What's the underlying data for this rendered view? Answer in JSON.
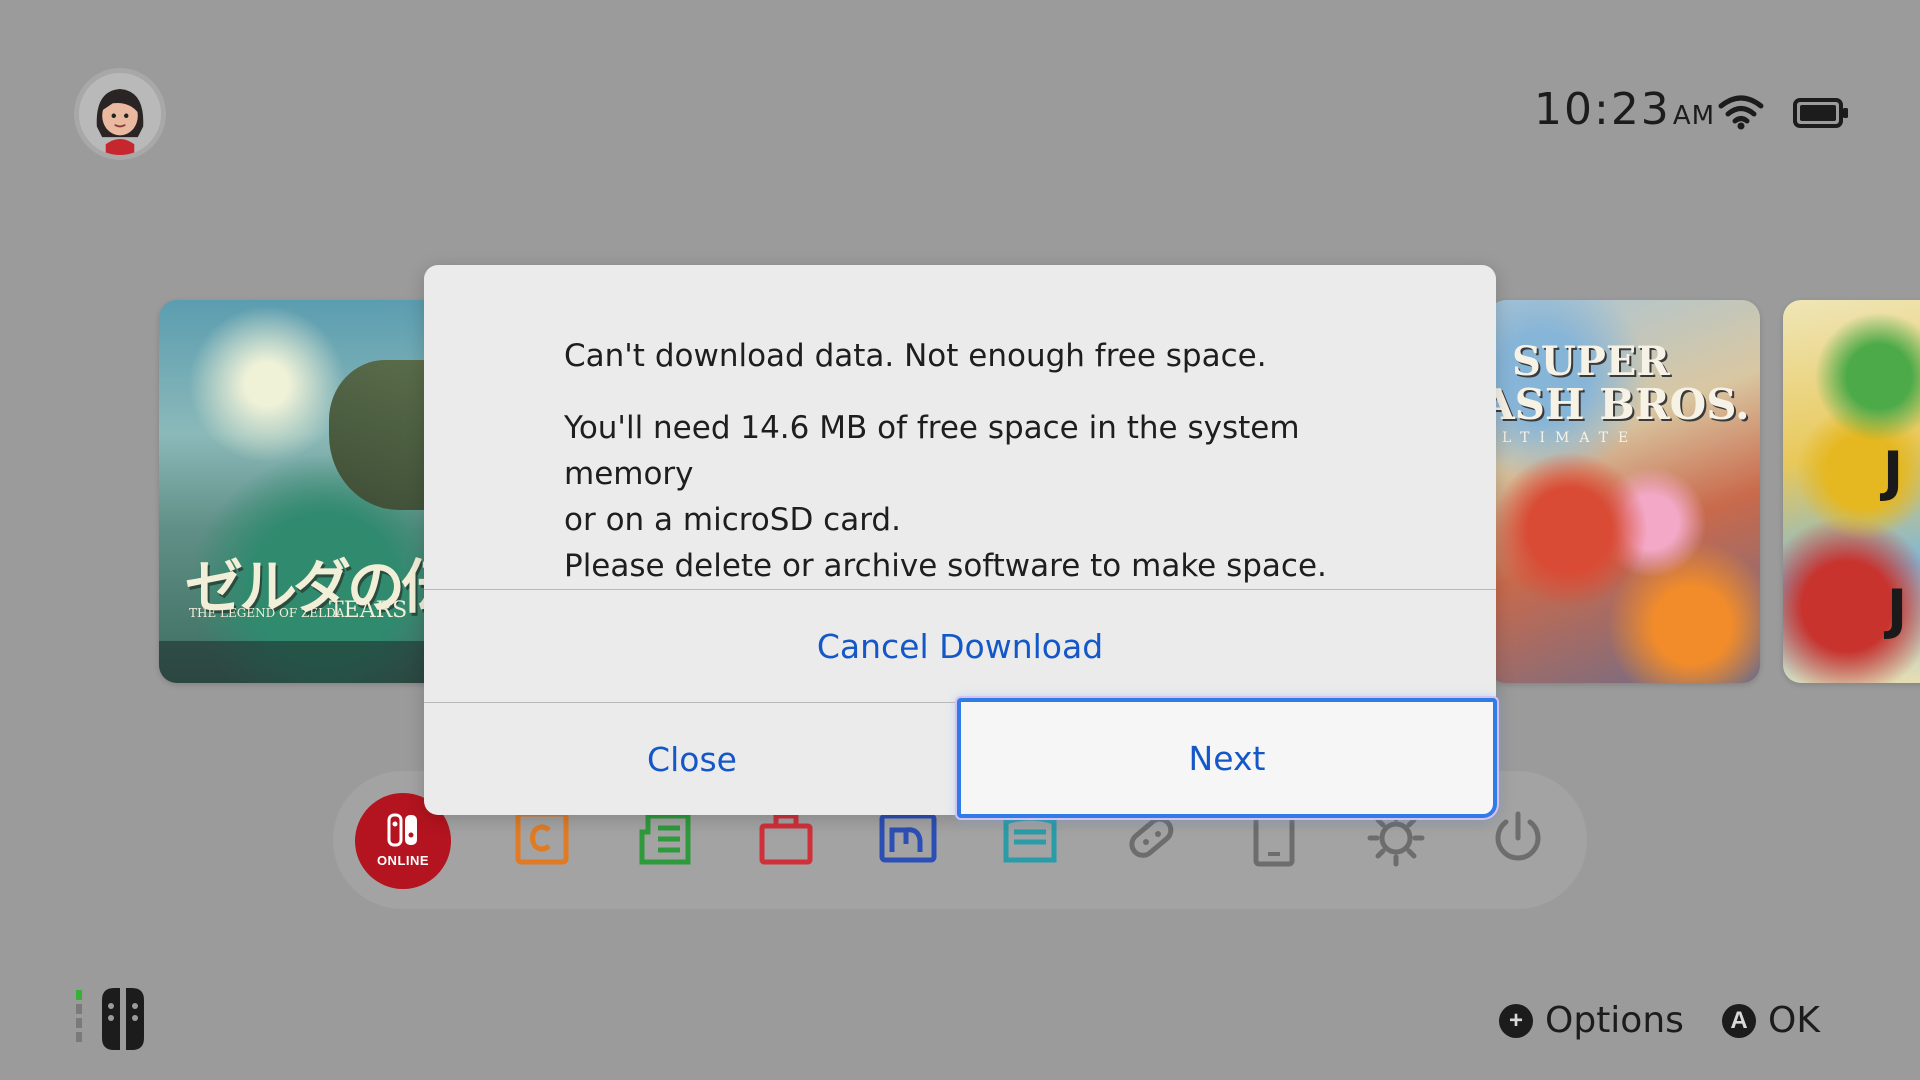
{
  "status": {
    "time": "10:23",
    "ampm": "AM",
    "icons": [
      "wifi-icon",
      "battery-icon"
    ]
  },
  "user": {
    "avatar": "avatar-icon"
  },
  "games": {
    "zelda": {
      "title_jp": "ゼルダの伝",
      "subtitle": "THE LEGEND OF ZELDA",
      "subtitle2": "TEARS"
    },
    "smash": {
      "line1": "SUPER",
      "line2": "ASH BROS.",
      "line3": "LTIMATE"
    },
    "mario": {
      "mark1": "J",
      "mark2": "J"
    }
  },
  "dock": {
    "online_label": "ONLINE",
    "items": [
      "nintendo-switch-online",
      "news",
      "album-list",
      "shop",
      "album",
      "controllers",
      "controller",
      "system-device",
      "system-settings",
      "power"
    ]
  },
  "dialog": {
    "title": "Can't download data. Not enough free space.",
    "body": "You'll need 14.6 MB of free space in the system memory\nor on a microSD card.\nPlease delete or archive software to make space.",
    "cancel_label": "Cancel Download",
    "close_label": "Close",
    "next_label": "Next"
  },
  "footer": {
    "options_label": "Options",
    "ok_label": "OK",
    "options_icon": "+",
    "ok_icon": "A"
  },
  "colors": {
    "background": "#9b9b9b",
    "dialog": "#ebebeb",
    "link_blue": "#1457c8",
    "online_red": "#b3141f",
    "focus_blue": "#2f7be8"
  }
}
